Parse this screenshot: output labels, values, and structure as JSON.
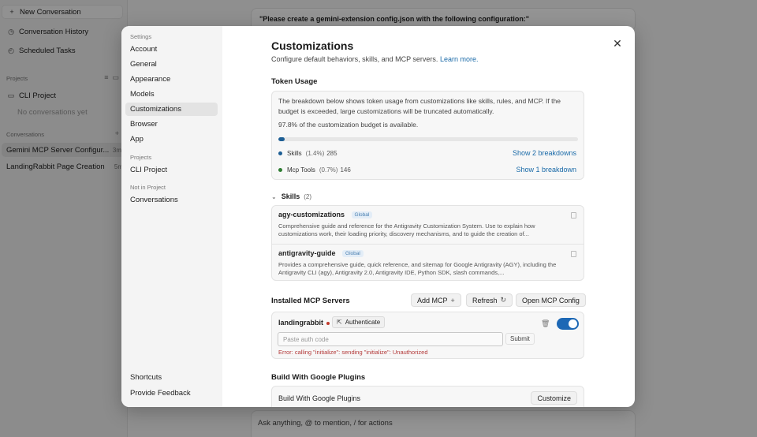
{
  "sidebar": {
    "new_conversation": "New Conversation",
    "history": "Conversation History",
    "scheduled": "Scheduled Tasks",
    "projects_head": "Projects",
    "project_name": "CLI Project",
    "no_conversations": "No conversations yet",
    "conversations_head": "Conversations",
    "conversations": [
      {
        "title": "Gemini MCP Server Configur...",
        "time": "3m"
      },
      {
        "title": "LandingRabbit Page Creation",
        "time": "5m"
      }
    ]
  },
  "main": {
    "prompt_preview": "\"Please create a gemini-extension config.json with the following configuration:\"",
    "composer_placeholder": "Ask anything, @ to mention, / for actions"
  },
  "settings_nav": {
    "settings_head": "Settings",
    "items": [
      "Account",
      "General",
      "Appearance",
      "Models",
      "Customizations",
      "Browser",
      "App"
    ],
    "active": "Customizations",
    "projects_head": "Projects",
    "project_item": "CLI Project",
    "not_in_project_head": "Not in Project",
    "not_in_project_item": "Conversations",
    "shortcuts": "Shortcuts",
    "feedback": "Provide Feedback"
  },
  "customizations": {
    "title": "Customizations",
    "subtitle": "Configure default behaviors, skills, and MCP servers.",
    "learn_more": "Learn more.",
    "token_usage": {
      "heading": "Token Usage",
      "description": "The breakdown below shows token usage from customizations like skills, rules, and MCP. If the budget is exceeded, large customizations will be truncated automatically.",
      "available_text": "97.8% of the customization budget is available.",
      "used_fraction": 0.022,
      "rows": [
        {
          "name": "Skills",
          "pct": "(1.4%)",
          "count": "285",
          "link": "Show 2 breakdowns",
          "color": "#1d5e94"
        },
        {
          "name": "Mcp Tools",
          "pct": "(0.7%)",
          "count": "146",
          "link": "Show 1 breakdown",
          "color": "#2e7d32"
        }
      ]
    },
    "skills": {
      "heading": "Skills",
      "count": "(2)",
      "items": [
        {
          "name": "agy-customizations",
          "badge": "Global",
          "description": "Comprehensive guide and reference for the Antigravity Customization System. Use to explain how customizations work, their loading priority, discovery mechanisms, and to guide the creation of..."
        },
        {
          "name": "antigravity-guide",
          "badge": "Global",
          "description": "Provides a comprehensive guide, quick reference, and sitemap for Google Antigravity (AGY), including the Antigravity CLI (agy), Antigravity 2.0, Antigravity IDE, Python SDK, slash commands,..."
        }
      ]
    },
    "mcp": {
      "heading": "Installed MCP Servers",
      "add_label": "Add MCP",
      "refresh_label": "Refresh",
      "open_config_label": "Open MCP Config",
      "server_name": "landingrabbit",
      "authenticate_label": "Authenticate",
      "auth_placeholder": "Paste auth code",
      "submit_label": "Submit",
      "error": "Error: calling \"initialize\": sending \"initialize\": Unauthorized",
      "enabled": true
    },
    "plugins": {
      "heading": "Build With Google Plugins",
      "row_label": "Build With Google Plugins",
      "customize_label": "Customize"
    }
  }
}
